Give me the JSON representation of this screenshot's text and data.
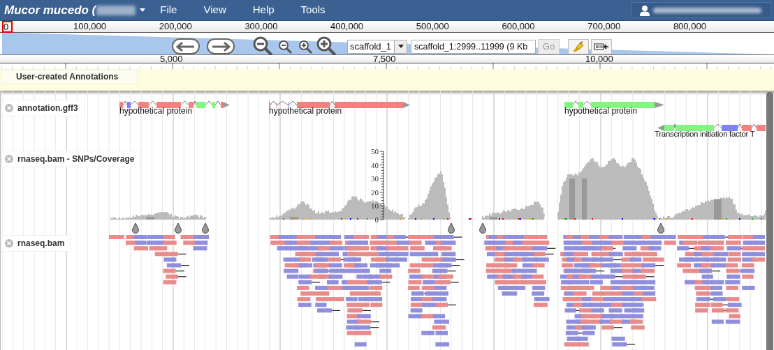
{
  "app": {
    "title": "Mucor mucedo (",
    "menu": [
      "File",
      "View",
      "Help",
      "Tools"
    ]
  },
  "overview": {
    "ticks": [
      "0",
      "100,000",
      "200,000",
      "300,000",
      "400,000",
      "500,000",
      "600,000",
      "700,000",
      "800,000"
    ]
  },
  "navigation": {
    "reference": "scaffold_1",
    "location": "scaffold_1:2999..11999 (9 Kb",
    "go": {
      "label": "Go",
      "disabled": true
    }
  },
  "detail_ruler": {
    "ticks": [
      "5,000",
      "7,500",
      "10,000"
    ]
  },
  "user_track": {
    "label": "User-created Annotations"
  },
  "tracks": [
    {
      "kind": "features",
      "label": "annotation.gff3",
      "features": [
        {
          "label": "hypothetical protein"
        },
        {
          "label": "hypothetical protein"
        },
        {
          "label": "hypothetical protein"
        },
        {
          "label": "Transcription initiation factor T"
        }
      ]
    },
    {
      "kind": "coverage",
      "label": "rnaseq.bam - SNPs/Coverage",
      "axis_labels": [
        "50",
        "40",
        "30",
        "20",
        "10",
        "0"
      ]
    },
    {
      "kind": "alignments",
      "label": "rnaseq.bam"
    }
  ]
}
